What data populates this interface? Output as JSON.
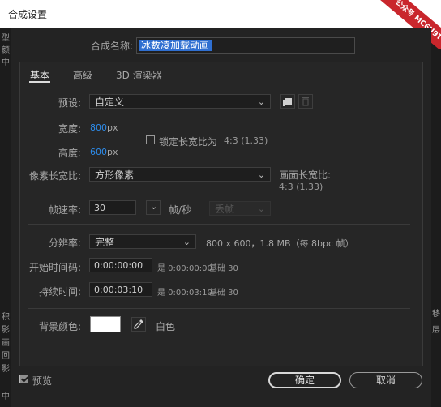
{
  "window": {
    "title": "合成设置",
    "watermark": "公众号 MC6U9T"
  },
  "composition_name": {
    "label": "合成名称:",
    "value": "冰数凌加载动画"
  },
  "tabs": [
    {
      "label": "基本"
    },
    {
      "label": "高级"
    },
    {
      "label": "3D 渲染器"
    }
  ],
  "preset": {
    "label": "预设:",
    "value": "自定义"
  },
  "width": {
    "label": "宽度:",
    "value": "800",
    "unit": "px"
  },
  "height": {
    "label": "高度:",
    "value": "600",
    "unit": "px"
  },
  "lock_ratio": {
    "label": "锁定长宽比为",
    "ratio": "4:3 (1.33)"
  },
  "pixel_aspect": {
    "label": "像素长宽比:",
    "value": "方形像素"
  },
  "frame_aspect": {
    "label": "画面长宽比:",
    "value": "4:3 (1.33)"
  },
  "frame_rate": {
    "label": "帧速率:",
    "value": "30",
    "unit": "帧/秒",
    "drop_value": "丢帧"
  },
  "resolution": {
    "label": "分辨率:",
    "value": "完整",
    "info": "800 x 600，1.8 MB（每 8bpc 帧）"
  },
  "start_timecode": {
    "label": "开始时间码:",
    "value": "0:00:00:00",
    "eq": "是 0:00:00:00",
    "base": "基础 30"
  },
  "duration": {
    "label": "持续时间:",
    "value": "0:00:03:10",
    "eq": "是 0:00:03:10",
    "base": "基础 30"
  },
  "bg_color": {
    "label": "背景颜色:",
    "name": "白色",
    "hex": "#ffffff"
  },
  "footer": {
    "preview_label": "预览",
    "ok": "确定",
    "cancel": "取消"
  },
  "background_app": {
    "left": [
      "型",
      "颜",
      "中",
      "鼓"
    ],
    "left_lower": [
      "积",
      "影",
      "画",
      "回",
      "影",
      "中"
    ],
    "right": [
      "移",
      "层"
    ]
  },
  "colors": {
    "accent": "#2d8ceb",
    "selection": "#2f6fd1"
  }
}
